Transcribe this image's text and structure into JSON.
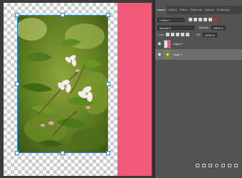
{
  "panel": {
    "tabs": [
      "Layers",
      "History",
      "Paths",
      "Channels",
      "Actions",
      "Properties"
    ],
    "active_tab": "Layers",
    "filter": {
      "label": "Kind"
    },
    "blend_mode": "Normal",
    "opacity_label": "Opacity:",
    "opacity_value": "100%",
    "lock_label": "Lock:",
    "fill_label": "Fill:",
    "fill_value": "100%"
  },
  "layers": [
    {
      "name": "Layer 2",
      "visible": true,
      "selected": false,
      "thumb": "transparent-pink"
    },
    {
      "name": "Layer 1",
      "visible": true,
      "selected": true,
      "thumb": "photo"
    }
  ],
  "canvas": {
    "pink_color": "#f25a7a",
    "photo_description_icon": "flower-photo"
  },
  "bottom_icons": [
    "link-icon",
    "fx-icon",
    "mask-icon",
    "adjustment-icon",
    "group-icon",
    "new-layer-icon",
    "trash-icon"
  ]
}
